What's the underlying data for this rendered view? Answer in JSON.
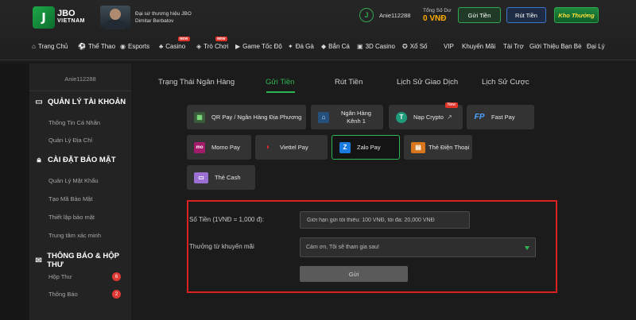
{
  "header": {
    "logo_line1": "JBO",
    "logo_line2": "VIETNAM",
    "logo_mark": "J",
    "ambassador_line1": "Đại sứ thương hiệu JBO",
    "ambassador_line2": "Dimitar Berbatov",
    "avatar_letter": "J",
    "username": "Anie112288",
    "balance_label": "Tổng Số Dư",
    "balance_value": "0 VNĐ",
    "deposit_button": "Gửi Tiền",
    "withdraw_button": "Rút Tiền",
    "store_button": "Kho Thưởng"
  },
  "nav": {
    "items": [
      {
        "label": "Trang Chủ",
        "icon": "home-icon"
      },
      {
        "label": "Thể Thao",
        "icon": "soccer-ball-icon"
      },
      {
        "label": "Esports",
        "icon": "gamepad-icon"
      },
      {
        "label": "Casino",
        "icon": "casino-chip-icon",
        "badge": "NEW"
      },
      {
        "label": "Trò Chơi",
        "icon": "controller-icon",
        "badge": "NEW"
      },
      {
        "label": "Game Tốc Độ",
        "icon": "speed-icon"
      },
      {
        "label": "Đá Gà",
        "icon": "rooster-icon"
      },
      {
        "label": "Bắn Cá",
        "icon": "fish-icon"
      },
      {
        "label": "3D Casino",
        "icon": "cards-3d-icon"
      },
      {
        "label": "Xổ Số",
        "icon": "lottery-icon"
      },
      {
        "label": "VIP"
      },
      {
        "label": "Khuyến Mãi"
      },
      {
        "label": "Tài Trợ"
      },
      {
        "label": "Giới Thiệu Bạn Bè"
      },
      {
        "label": "Đại Lý"
      }
    ]
  },
  "sidebar": {
    "username": "Anie112288",
    "sections": [
      {
        "title": "QUẢN LÝ TÀI KHOẢN",
        "icon": "id-card-icon",
        "items": [
          "Thông Tin Cá Nhân",
          "Quản Lý Địa Chỉ"
        ]
      },
      {
        "title": "CÀI ĐẶT BẢO MẬT",
        "icon": "lock-icon",
        "items": [
          "Quản Lý Mật Khẩu",
          "Tạo Mã Bảo Mật",
          "Thiết lập bảo mật",
          "Trung tâm xác minh"
        ]
      },
      {
        "title": "THÔNG BÁO & HỘP THƯ",
        "icon": "envelope-icon",
        "items": [
          "Hộp Thư",
          "Thông Báo"
        ],
        "counts": [
          "6",
          "2"
        ]
      }
    ]
  },
  "tabs": [
    "Trạng Thái Ngân Hàng",
    "Gửi Tiền",
    "Rút Tiền",
    "Lịch Sử Giao Dịch",
    "Lịch Sử Cược"
  ],
  "active_tab": "Gửi Tiền",
  "payment_methods": [
    {
      "label": "QR Pay / Ngân Hàng Địa Phương",
      "icon": "qr-code-icon"
    },
    {
      "label": "Ngân Hàng Kênh 1",
      "icon": "bank-icon"
    },
    {
      "label": "Nạp Crypto",
      "icon": "tether-icon",
      "badge": "New"
    },
    {
      "label": "Fast Pay",
      "icon": "fastpay-icon"
    },
    {
      "label": "Momo Pay",
      "icon": "momo-icon"
    },
    {
      "label": "Viettel Pay",
      "icon": "viettel-icon"
    },
    {
      "label": "Zalo Pay",
      "icon": "zalo-icon",
      "active": true
    },
    {
      "label": "Thẻ Điện Thoại",
      "icon": "phone-card-icon"
    },
    {
      "label": "Thẻ Cash",
      "icon": "cash-card-icon"
    }
  ],
  "form": {
    "amount_label": "Số Tiền (1VNĐ = 1,000 đ):",
    "amount_placeholder": "Giới hạn gửi tối thiểu: 100 VNĐ, tối đa: 20,000 VNĐ",
    "promo_label": "Thưởng từ khuyến mãi",
    "promo_value": "Cám ơn, Tôi sẽ tham gia sau!",
    "submit": "Gửi"
  },
  "colors": {
    "accent_green": "#2fb654",
    "balance_orange": "#ffae00",
    "highlight_red": "#d9211f"
  }
}
